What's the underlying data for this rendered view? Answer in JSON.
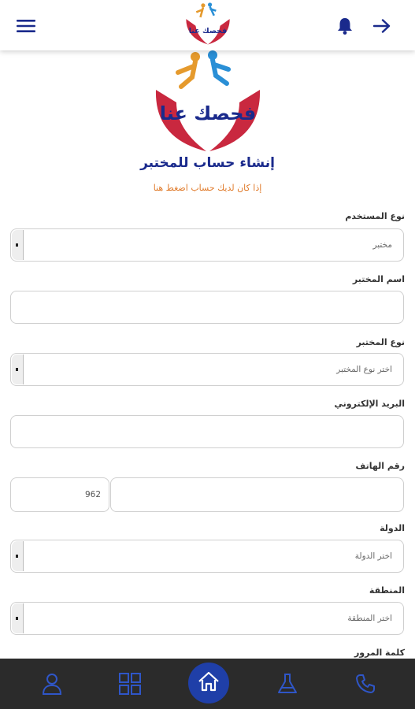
{
  "header": {
    "menu_icon": "hamburger-icon",
    "bell_icon": "bell-icon",
    "back_icon": "arrow-right-icon",
    "accent": "#1a2a8c",
    "logo_text": "فحصك عنا"
  },
  "page": {
    "title": "إنشاء حساب للمختبر",
    "login_link": "إذا كان لديك حساب اضغط هنا",
    "link_color": "#e07a2a"
  },
  "form": {
    "user_type": {
      "label": "نوع المستخدم",
      "value": "مختبر"
    },
    "lab_name": {
      "label": "اسم المختبر",
      "value": ""
    },
    "lab_type": {
      "label": "نوع المختبر",
      "placeholder": "اختر نوع المختبر"
    },
    "email": {
      "label": "البريد الإلكتروني",
      "value": ""
    },
    "phone": {
      "label": "رقم الهاتف",
      "code": "962",
      "value": ""
    },
    "country": {
      "label": "الدولة",
      "placeholder": "اختر الدولة"
    },
    "region": {
      "label": "المنطقة",
      "placeholder": "اختر المنطقة"
    },
    "password": {
      "label": "كلمة المرور"
    }
  },
  "bottom_nav": {
    "background": "#2b2b2b",
    "active_color": "#1f3fa8",
    "items": [
      "user-icon",
      "grid-icon",
      "home-icon",
      "flask-icon",
      "phone-icon"
    ]
  }
}
